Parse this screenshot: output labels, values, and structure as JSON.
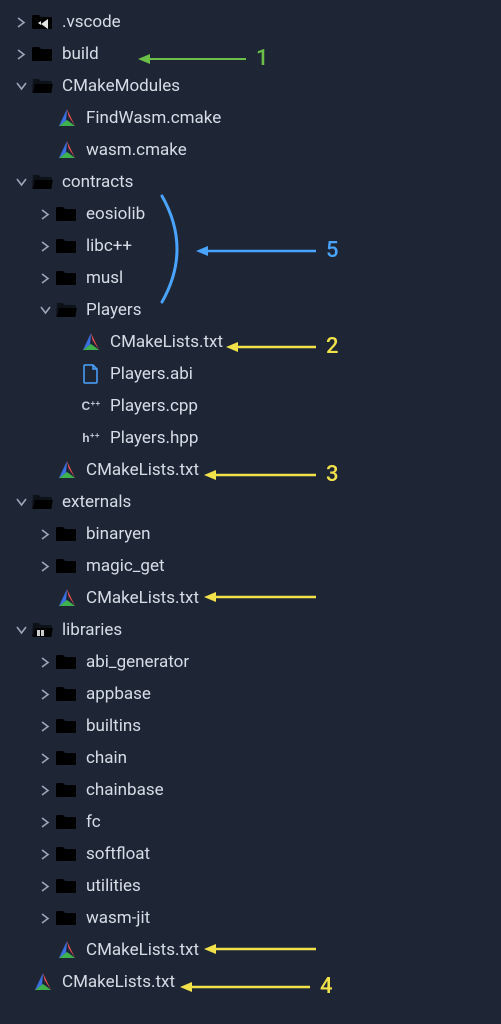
{
  "tree": {
    "vscode": ".vscode",
    "build": "build",
    "cmakeModules": "CMakeModules",
    "findWasm": "FindWasm.cmake",
    "wasmCmake": "wasm.cmake",
    "contracts": "contracts",
    "eosiolib": "eosiolib",
    "libcpp": "libc++",
    "musl": "musl",
    "players": "Players",
    "playersCmakeLists": "CMakeLists.txt",
    "playersAbi": "Players.abi",
    "playersCpp": "Players.cpp",
    "playersHpp": "Players.hpp",
    "contractsCmakeLists": "CMakeLists.txt",
    "externals": "externals",
    "binaryen": "binaryen",
    "magicGet": "magic_get",
    "externalsCmakeLists": "CMakeLists.txt",
    "libraries": "libraries",
    "abiGenerator": "abi_generator",
    "appbase": "appbase",
    "builtins": "builtins",
    "chain": "chain",
    "chainbase": "chainbase",
    "fc": "fc",
    "softfloat": "softfloat",
    "utilities": "utilities",
    "wasmJit": "wasm-jit",
    "librariesCmakeLists": "CMakeLists.txt",
    "rootCmakeLists": "CMakeLists.txt"
  },
  "annotations": {
    "n1": "1",
    "n2": "2",
    "n3": "3",
    "n4": "4",
    "n5": "5"
  },
  "icons": {
    "cpp_prefix": "C",
    "cpp_suffix": "++",
    "hpp_prefix": "h",
    "hpp_suffix": "++"
  }
}
